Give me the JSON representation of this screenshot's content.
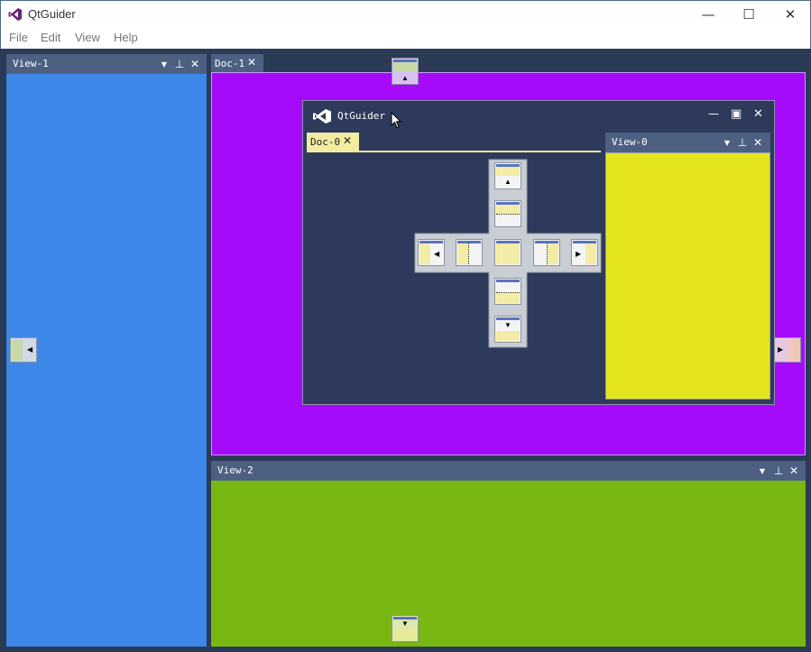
{
  "window": {
    "title": "QtGuider",
    "minimize": "—",
    "maximize": "☐",
    "close": "✕"
  },
  "menu": [
    "File",
    "Edit",
    "View",
    "Help"
  ],
  "panels": {
    "view1": {
      "title": "View-1",
      "color": "#3c87e8"
    },
    "view2": {
      "title": "View-2",
      "color": "#79b712"
    },
    "view0": {
      "title": "View-0",
      "color": "#e5e51d"
    }
  },
  "docs": {
    "doc1": {
      "title": "Doc-1",
      "color": "#a60afb"
    },
    "doc0": {
      "title": "Doc-0"
    }
  },
  "floating": {
    "title": "QtGuider",
    "minimize": "—",
    "maximize": "▣",
    "close": "✕"
  },
  "icons": {
    "dropdown": "▼",
    "pin": "⊥",
    "close": "✕",
    "arrow_up": "▲",
    "arrow_down": "▼",
    "arrow_left": "◀",
    "arrow_right": "▶"
  }
}
